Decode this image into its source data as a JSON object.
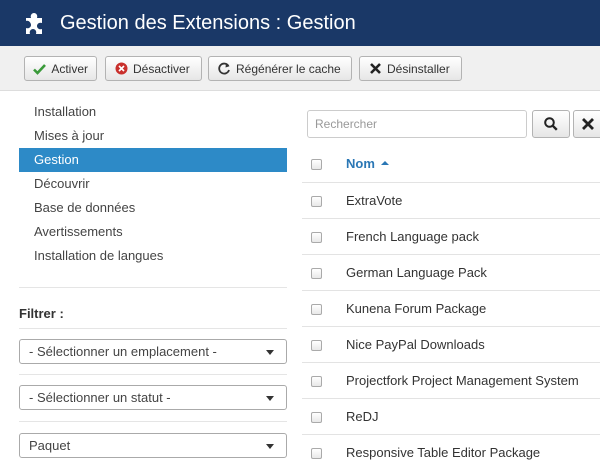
{
  "header": {
    "title": "Gestion des Extensions : Gestion",
    "icon": "puzzle-icon"
  },
  "toolbar": {
    "activate_label": "Activer",
    "deactivate_label": "Désactiver",
    "refresh_cache_label": "Régénérer le cache",
    "uninstall_label": "Désinstaller"
  },
  "sidebar": {
    "items": [
      {
        "label": "Installation"
      },
      {
        "label": "Mises à jour"
      },
      {
        "label": "Gestion",
        "active": true
      },
      {
        "label": "Découvrir"
      },
      {
        "label": "Base de données"
      },
      {
        "label": "Avertissements"
      },
      {
        "label": "Installation de langues"
      }
    ]
  },
  "filters": {
    "label": "Filtrer :",
    "location": "- Sélectionner un emplacement -",
    "status": "- Sélectionner un statut -",
    "type": "Paquet"
  },
  "search": {
    "placeholder": "Rechercher"
  },
  "table": {
    "column_name": "Nom",
    "rows": [
      "ExtraVote",
      "French Language pack",
      "German Language Pack",
      "Kunena Forum Package",
      "Nice PayPal Downloads",
      "Projectfork Project Management System",
      "ReDJ",
      "Responsive Table Editor Package"
    ]
  },
  "colors": {
    "header_bg": "#1a3867",
    "active_nav": "#2d8ac7",
    "link": "#2a77b5",
    "success": "#3a9a3a",
    "danger": "#c9302c"
  }
}
